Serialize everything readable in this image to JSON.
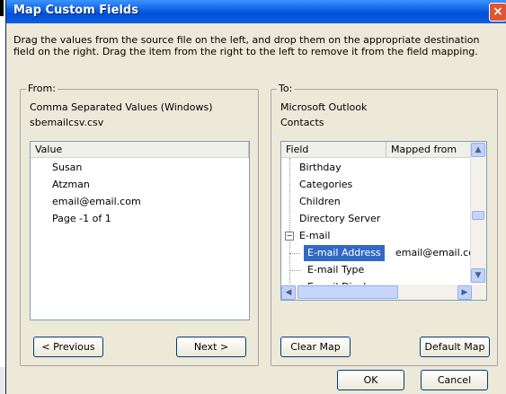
{
  "dialog": {
    "title": "Map Custom Fields",
    "close_glyph": "×",
    "instructions": "Drag the values from the source file on the left, and drop them on the appropriate destination field on the right.  Drag the item from the right to the left to remove it from the field mapping."
  },
  "from": {
    "label": "From:",
    "source_type": "Comma Separated Values (Windows)",
    "file_name": "sbemailcsv.csv",
    "column_header": "Value",
    "values": [
      "Susan",
      "Atzman",
      "email@email.com",
      "Page -1 of 1"
    ],
    "previous_label": "< Previous",
    "next_label": "Next >"
  },
  "to": {
    "label": "To:",
    "app_name": "Microsoft Outlook",
    "folder": "Contacts",
    "columns": [
      "Field",
      "Mapped from"
    ],
    "fields": [
      "Birthday",
      "Categories",
      "Children",
      "Directory Server"
    ],
    "email_group": "E-mail",
    "email_group_expander": "−",
    "email_children": [
      {
        "name": "E-mail Address",
        "mapped": "email@email.com"
      },
      {
        "name": "E-mail Type",
        "mapped": ""
      },
      {
        "name": "E-mail Display",
        "mapped": ""
      }
    ],
    "clear_label": "Clear Map",
    "default_label": "Default Map"
  },
  "footer": {
    "ok_label": "OK",
    "cancel_label": "Cancel"
  },
  "icons": {
    "scroll_up": "up-arrow-icon",
    "scroll_down": "down-arrow-icon",
    "scroll_left": "left-arrow-icon",
    "scroll_right": "right-arrow-icon"
  },
  "colors": {
    "titlebar": "#0a5fe5",
    "selection": "#316ac5",
    "close": "#e0552f",
    "dialog_bg": "#ece9d8"
  }
}
